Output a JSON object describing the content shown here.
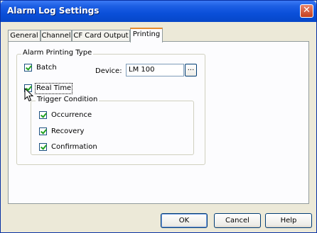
{
  "window": {
    "title": "Alarm Log Settings",
    "close_glyph": "✕"
  },
  "tabs": [
    {
      "label": "General",
      "active": false
    },
    {
      "label": "Channel",
      "active": false
    },
    {
      "label": "CF Card Output",
      "active": false
    },
    {
      "label": "Printing",
      "active": true
    }
  ],
  "printing": {
    "group_label": "Alarm Printing Type",
    "batch": {
      "label": "Batch",
      "checked": true
    },
    "device": {
      "label": "Device:",
      "value": "LM 100",
      "browse_label": "..."
    },
    "real_time": {
      "label": "Real Time",
      "checked": true
    },
    "trigger": {
      "group_label": "Trigger Condition",
      "occurrence": {
        "label": "Occurrence",
        "checked": true
      },
      "recovery": {
        "label": "Recovery",
        "checked": true
      },
      "confirmation": {
        "label": "Confirmation",
        "checked": true
      }
    }
  },
  "buttons": {
    "ok": "OK",
    "cancel": "Cancel",
    "help": "Help"
  },
  "colors": {
    "titlebar": "#0a4fd9",
    "dialog_bg": "#ece9d8",
    "check": "#21a121",
    "active_tab_accent": "#e68b2c"
  },
  "icons": {
    "close": "close-icon",
    "cursor": "mouse-pointer-icon"
  }
}
